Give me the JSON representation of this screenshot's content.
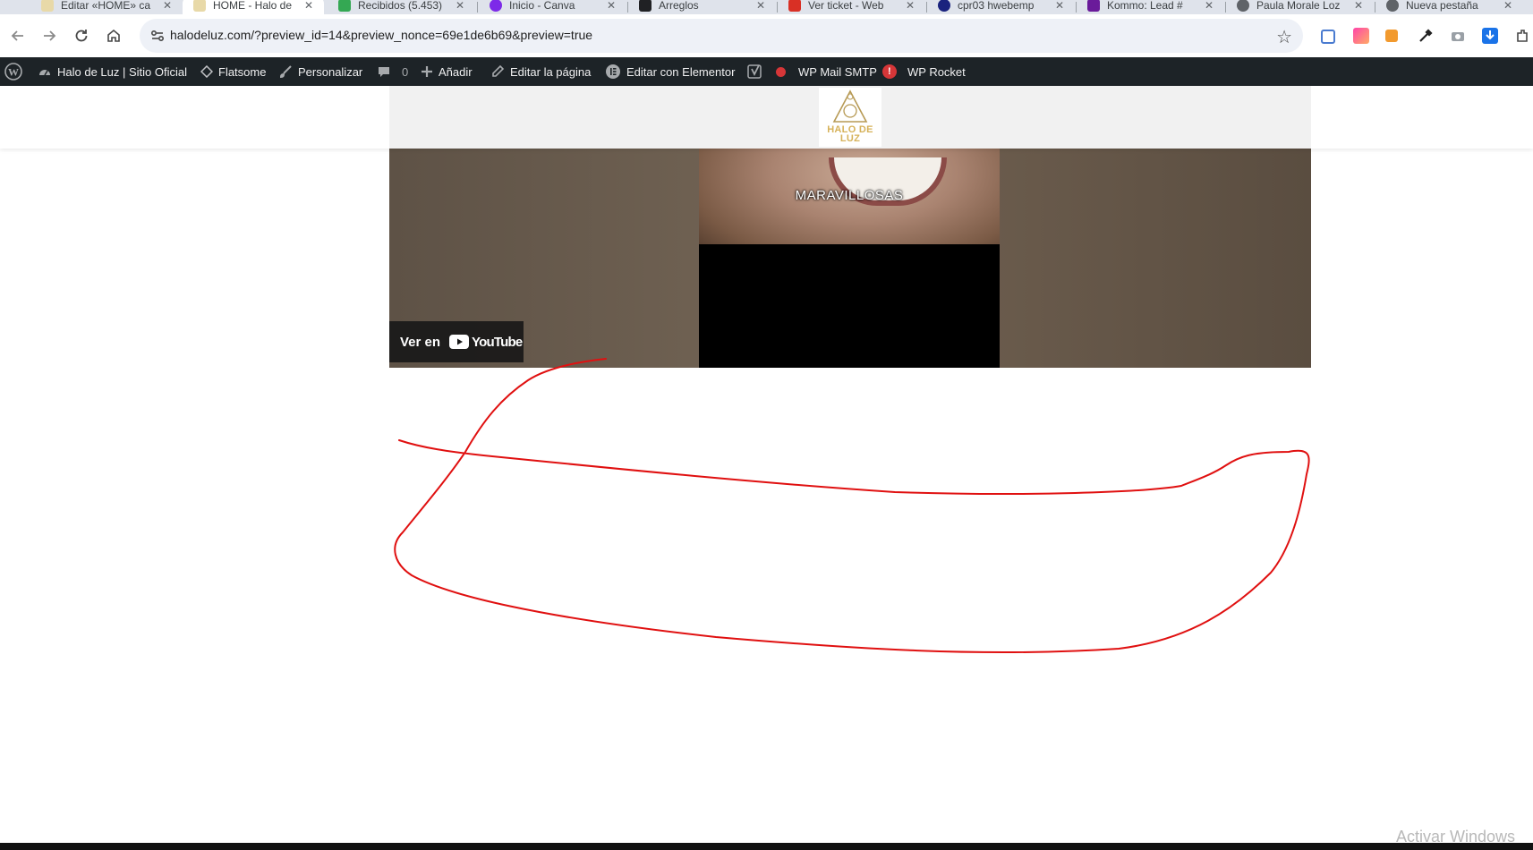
{
  "browser": {
    "tabs": [
      {
        "title": "Editar «HOME» ca",
        "color": "#e8d9a8",
        "active": false
      },
      {
        "title": "HOME - Halo de",
        "color": "#e8d9a8",
        "active": true
      },
      {
        "title": "Recibidos (5.453)",
        "color": "#34a853",
        "active": false
      },
      {
        "title": "Inicio - Canva",
        "color": "#7d2ae8",
        "active": false
      },
      {
        "title": "Arreglos",
        "color": "#202124",
        "active": false
      },
      {
        "title": "Ver ticket - Web",
        "color": "#d93025",
        "active": false
      },
      {
        "title": "cpr03 hwebemp",
        "color": "#1a237e",
        "active": false
      },
      {
        "title": "Kommo: Lead #",
        "color": "#6a1b9a",
        "active": false
      },
      {
        "title": "Paula Morale Loz",
        "color": "#5f6368",
        "active": false
      },
      {
        "title": "Nueva pestaña",
        "color": "#5f6368",
        "active": false
      }
    ],
    "url": "halodeluz.com/?preview_id=14&preview_nonce=69e1de6b69&preview=true"
  },
  "adminbar": {
    "site_name": "Halo de Luz | Sitio Oficial",
    "theme": "Flatsome",
    "customize": "Personalizar",
    "comments_count": "0",
    "add_new": "Añadir",
    "edit_page": "Editar la página",
    "elementor": "Editar con Elementor",
    "smtp": "WP Mail SMTP",
    "smtp_alert": "!",
    "rocket": "WP Rocket"
  },
  "site": {
    "logo_text": "HALO DE LUZ"
  },
  "video": {
    "caption": "MARAVILLOSAS",
    "watch_on": "Ver en",
    "youtube_wordmark": "YouTube"
  },
  "annotation": {
    "color": "#e01010"
  },
  "system": {
    "watermark": "Activar Windows"
  }
}
